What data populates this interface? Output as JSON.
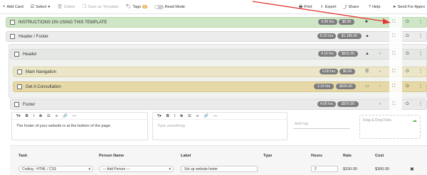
{
  "toolbar": {
    "add_card": "Add Card",
    "select": "Select",
    "delete": "Delete",
    "save_template": "Save as Template",
    "tags": "Tags",
    "tags_count": "0",
    "read_mode": "Read Mode",
    "print": "Print",
    "export": "Export",
    "share": "Share",
    "help": "Help",
    "send": "Send For Appro"
  },
  "sections": [
    {
      "title": "INSTRUCTIONS ON USING THIS TEMPLATE",
      "time": "0.00 hrs",
      "cost": "$0.00"
    },
    {
      "title": "Header / Footer",
      "time": "8.10 hrs",
      "cost": "$1,185.00"
    },
    {
      "title": "Header",
      "time": "4.10 hrs",
      "cost": "$615.00"
    },
    {
      "title": "Main Navigation",
      "time": "0.00 hrs",
      "cost": "$0.00"
    },
    {
      "title": "Get A Consultation",
      "time": "2.10 hrs",
      "cost": "$315.00"
    },
    {
      "title": "Footer",
      "time": "4.00 hrs",
      "cost": "$570.00"
    }
  ],
  "editor1": {
    "text": "The footer of your website is at the bottom of the page."
  },
  "editor2": {
    "placeholder": "Type something"
  },
  "tag_input": {
    "placeholder": "Add tag"
  },
  "dropzone": {
    "label": "Drag & Drop Files"
  },
  "table": {
    "headers": [
      "Task",
      "Person Name",
      "Label",
      "Type",
      "Hours",
      "Rate",
      "Cost"
    ],
    "row": {
      "task": "Coding - HTML / CSS",
      "person": "--- Add Person ---",
      "label": "Set up website footer",
      "hours": "2",
      "rate": "$150.00",
      "cost": "$300.00"
    }
  }
}
